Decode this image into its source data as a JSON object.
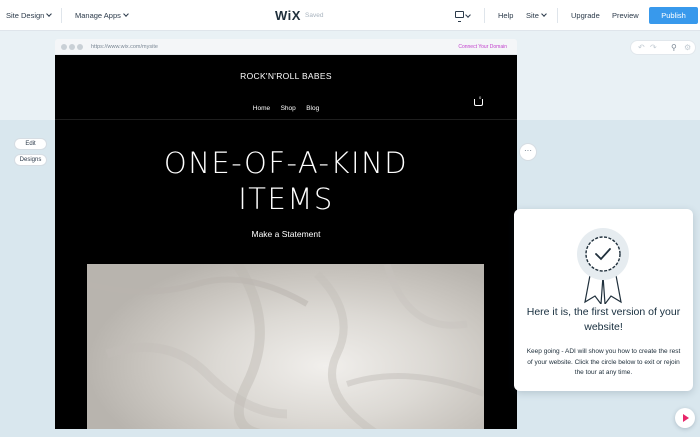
{
  "topbar": {
    "site_design": "Site Design",
    "manage_apps": "Manage Apps",
    "logo": "WiX",
    "saved": "Saved",
    "help": "Help",
    "site": "Site",
    "upgrade": "Upgrade",
    "preview": "Preview",
    "publish": "Publish",
    "publish_color": "#3899ec"
  },
  "browser": {
    "url": "https://www.wix.com/mysite",
    "connect_domain": "Connect Your Domain"
  },
  "site": {
    "title": "ROCK'N'ROLL BABES",
    "nav": [
      "Home",
      "Shop",
      "Blog"
    ],
    "cart_count": "0",
    "hero_line1": "ONE-OF-A-KIND",
    "hero_line2": "ITEMS",
    "tagline": "Make a Statement"
  },
  "side_buttons": {
    "edit": "Edit",
    "designs": "Designs",
    "more": "···"
  },
  "tour_panel": {
    "heading": "Here it is, the first version of your website!",
    "body": "Keep going - ADI will show you how to create the rest of your website. Click the circle below to exit or rejoin the tour at any time.",
    "badge_icon": "ribbon-checkmark-icon",
    "play_color": "#e8266a"
  }
}
